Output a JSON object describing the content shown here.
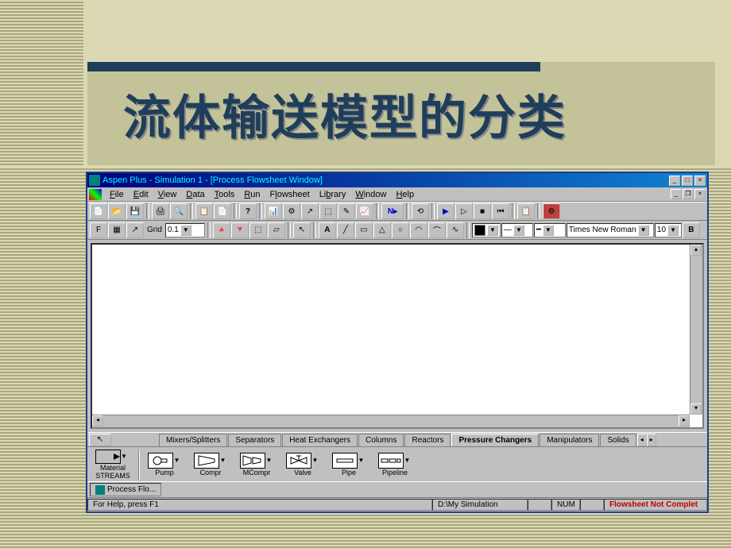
{
  "slide": {
    "title": "流体输送模型的分类"
  },
  "titlebar": {
    "text": "Aspen Plus - Simulation 1 - [Process Flowsheet Window]"
  },
  "menus": [
    "File",
    "Edit",
    "View",
    "Data",
    "Tools",
    "Run",
    "Flowsheet",
    "Library",
    "Window",
    "Help"
  ],
  "toolbar2": {
    "grid_label": "Grid",
    "grid_value": "0.1",
    "font_name": "Times New Roman",
    "font_size": "10"
  },
  "model_tabs": [
    "Mixers/Splitters",
    "Separators",
    "Heat Exchangers",
    "Columns",
    "Reactors",
    "Pressure Changers",
    "Manipulators",
    "Solids"
  ],
  "active_tab_index": 5,
  "streams": {
    "label1": "Material",
    "label2": "STREAMS"
  },
  "blocks": [
    {
      "label": "Pump",
      "caption": "PUMP"
    },
    {
      "label": "Compr",
      "caption": "COMPR"
    },
    {
      "label": "MCompr",
      "caption": "MCOMPR"
    },
    {
      "label": "Valve",
      "caption": "VALVE"
    },
    {
      "label": "Pipe",
      "caption": "PIPE"
    },
    {
      "label": "Pipeline",
      "caption": "PIPELINE"
    }
  ],
  "taskbar": {
    "item": "Process Flo..."
  },
  "statusbar": {
    "help": "For Help, press F1",
    "path": "D:\\My Simulation",
    "num": "NUM",
    "status": "Flowsheet Not Complet"
  }
}
